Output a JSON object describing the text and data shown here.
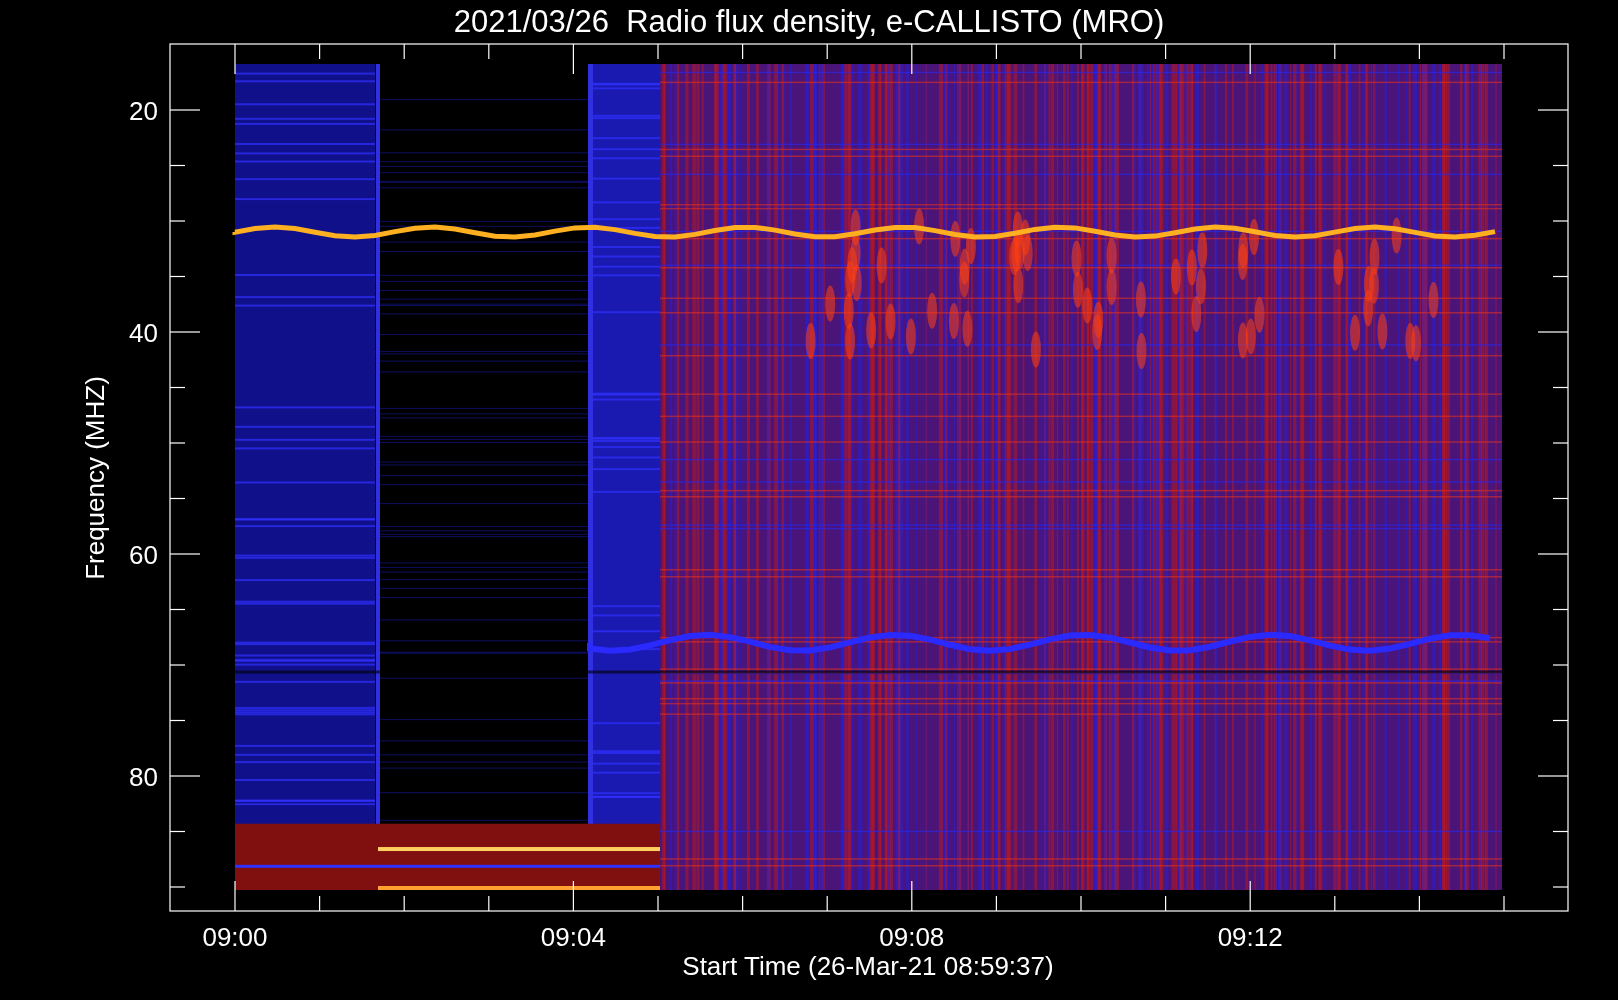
{
  "title": "2021/03/26  Radio flux density, e-CALLISTO (MRO)",
  "y_axis": {
    "label": "Frequency (MHZ)",
    "ticks": [
      "20",
      "40",
      "60",
      "80"
    ]
  },
  "x_axis": {
    "label": "Start Time (26-Mar-21 08:59:37)",
    "ticks": [
      "09:00",
      "09:04",
      "09:08",
      "09:12"
    ]
  }
}
